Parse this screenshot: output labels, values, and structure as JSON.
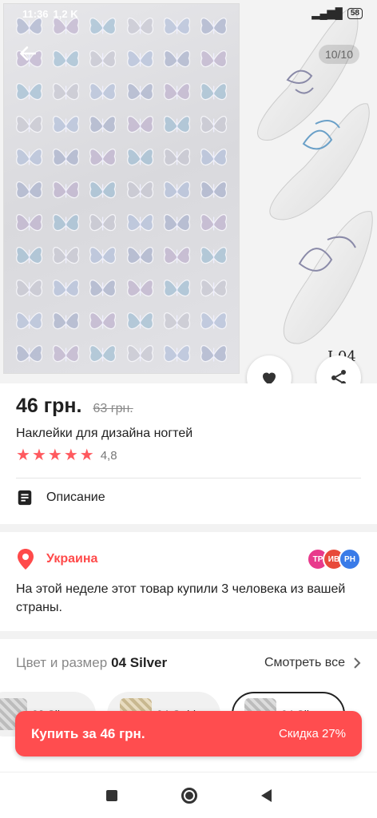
{
  "status_bar": {
    "time": "11:36",
    "net_speed": "1,2 K",
    "signal": "▂▄▆█",
    "battery": "58"
  },
  "gallery": {
    "counter": "10/10",
    "nail_label": "I 04",
    "back_icon": "arrow-left-icon",
    "favorite_icon": "heart-icon",
    "share_icon": "share-icon"
  },
  "product": {
    "price": "46 грн.",
    "old_price": "63 грн.",
    "title": "Наклейки для дизайна ногтей",
    "rating_value": "4,8",
    "stars": 5
  },
  "description": {
    "label": "Описание",
    "icon": "document-icon"
  },
  "location": {
    "country": "Украина",
    "icon": "location-pin-icon",
    "avatars": [
      {
        "initials": "TP",
        "color": "#e83a8c"
      },
      {
        "initials": "ИВ",
        "color": "#e84a3a"
      },
      {
        "initials": "PH",
        "color": "#3a7be8"
      }
    ],
    "text": "На этой неделе этот товар купили 3 человека из вашей страны."
  },
  "color_size": {
    "label": "Цвет и размер",
    "selected": "04 Silver",
    "see_all": "Смотреть все",
    "variants": [
      {
        "label": "03 Sil..."
      },
      {
        "label": "04 Gold..."
      },
      {
        "label": "04 Sil..."
      }
    ]
  },
  "buy": {
    "label": "Купить за 46 грн.",
    "discount": "Скидка 27%"
  },
  "colors": {
    "accent": "#ff4d4f",
    "star": "#ff5a5f",
    "location": "#ff4a4a"
  }
}
